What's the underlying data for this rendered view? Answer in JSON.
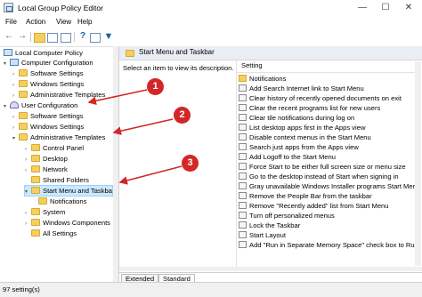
{
  "window": {
    "title": "Local Group Policy Editor",
    "minimize": "—",
    "maximize": "☐",
    "close": "✕"
  },
  "menu": [
    "File",
    "Action",
    "View",
    "Help"
  ],
  "toolbar": {
    "icons": [
      "back-arrow-icon",
      "forward-arrow-icon",
      "folder-up-icon",
      "show-hide-tree-icon",
      "export-list-icon",
      "help-icon",
      "properties-icon",
      "filter-icon"
    ]
  },
  "tree": {
    "root": "Local Computer Policy",
    "computer_configuration": "Computer Configuration",
    "cc_software_settings": "Software Settings",
    "cc_windows_settings": "Windows Settings",
    "cc_admin_templates": "Administrative Templates",
    "user_configuration": "User Configuration",
    "uc_software_settings": "Software Settings",
    "uc_windows_settings": "Windows Settings",
    "uc_admin_templates": "Administrative Templates",
    "control_panel": "Control Panel",
    "desktop": "Desktop",
    "network": "Network",
    "shared_folders": "Shared Folders",
    "start_menu_taskbar": "Start Menu and Taskbar",
    "notifications": "Notifications",
    "system": "System",
    "windows_components": "Windows Components",
    "all_settings": "All Settings"
  },
  "right": {
    "header": "Start Menu and Taskbar",
    "description": "Select an item to view its description.",
    "column": "Setting",
    "settings": [
      "Notifications",
      "Add Search Internet link to Start Menu",
      "Clear history of recently opened documents on exit",
      "Clear the recent programs list for new users",
      "Clear tile notifications during log on",
      "List desktop apps first in the Apps view",
      "Disable context menus in the Start Menu",
      "Search just apps from the Apps view",
      "Add Logoff to the Start Menu",
      "Force Start to be either full screen size or menu size",
      "Go to the desktop instead of Start when signing in",
      "Gray unavailable Windows Installer programs Start Menu",
      "Remove the People Bar from the taskbar",
      "Remove \"Recently added\" list from Start Menu",
      "Turn off personalized menus",
      "Lock the Taskbar",
      "Start Layout",
      "Add \"Run in Separate Memory Space\" check box to Run"
    ]
  },
  "tabs": [
    "Extended",
    "Standard"
  ],
  "status": "97 setting(s)",
  "callouts": [
    "1",
    "2",
    "3"
  ],
  "accent": {
    "callout": "#d32627",
    "selection": "#cce8ff",
    "folder": "#f3cf60"
  }
}
